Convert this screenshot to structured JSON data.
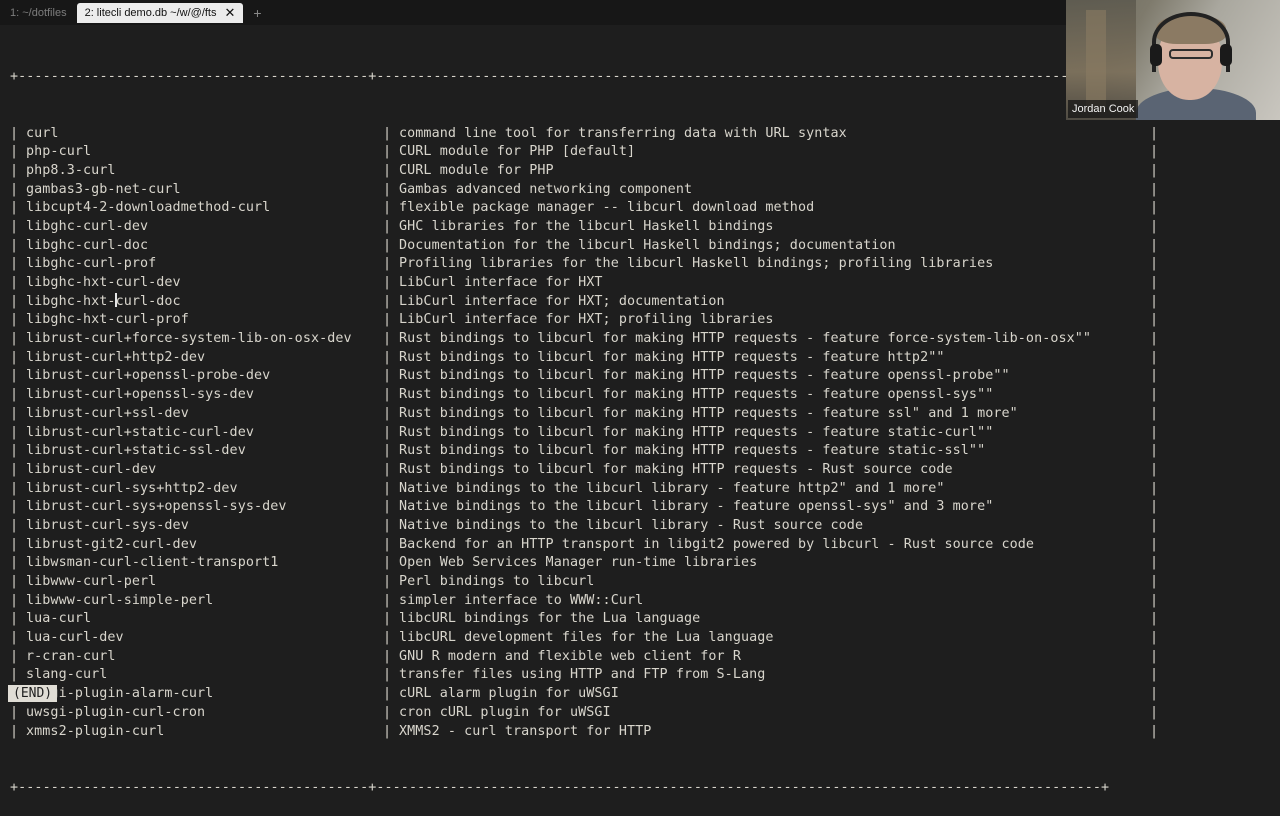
{
  "tabs": [
    {
      "label": "1: ~/dotfiles",
      "active": false
    },
    {
      "label": "2: litecli demo.db ~/w/@/fts",
      "active": true
    }
  ],
  "tab_close_glyph": "✕",
  "tab_add_glyph": "+",
  "table": {
    "border_top": "+-------------------------------------------+-----------------------------------------------------------------------------------------+",
    "border_bottom": "+-------------------------------------------+-----------------------------------------------------------------------------------------+",
    "rows": [
      {
        "name": "curl",
        "desc": "command line tool for transferring data with URL syntax"
      },
      {
        "name": "php-curl",
        "desc": "CURL module for PHP [default]"
      },
      {
        "name": "php8.3-curl",
        "desc": "CURL module for PHP"
      },
      {
        "name": "gambas3-gb-net-curl",
        "desc": "Gambas advanced networking component"
      },
      {
        "name": "libcupt4-2-downloadmethod-curl",
        "desc": "flexible package manager -- libcurl download method"
      },
      {
        "name": "libghc-curl-dev",
        "desc": "GHC libraries for the libcurl Haskell bindings"
      },
      {
        "name": "libghc-curl-doc",
        "desc": "Documentation for the libcurl Haskell bindings; documentation"
      },
      {
        "name": "libghc-curl-prof",
        "desc": "Profiling libraries for the libcurl Haskell bindings; profiling libraries"
      },
      {
        "name": "libghc-hxt-curl-dev",
        "desc": "LibCurl interface for HXT"
      },
      {
        "name": "libghc-hxt-curl-doc",
        "desc": "LibCurl interface for HXT; documentation"
      },
      {
        "name": "libghc-hxt-curl-prof",
        "desc": "LibCurl interface for HXT; profiling libraries"
      },
      {
        "name": "librust-curl+force-system-lib-on-osx-dev",
        "desc": "Rust bindings to libcurl for making HTTP requests - feature force-system-lib-on-osx\"\""
      },
      {
        "name": "librust-curl+http2-dev",
        "desc": "Rust bindings to libcurl for making HTTP requests - feature http2\"\""
      },
      {
        "name": "librust-curl+openssl-probe-dev",
        "desc": "Rust bindings to libcurl for making HTTP requests - feature openssl-probe\"\""
      },
      {
        "name": "librust-curl+openssl-sys-dev",
        "desc": "Rust bindings to libcurl for making HTTP requests - feature openssl-sys\"\""
      },
      {
        "name": "librust-curl+ssl-dev",
        "desc": "Rust bindings to libcurl for making HTTP requests - feature ssl\" and 1 more\""
      },
      {
        "name": "librust-curl+static-curl-dev",
        "desc": "Rust bindings to libcurl for making HTTP requests - feature static-curl\"\""
      },
      {
        "name": "librust-curl+static-ssl-dev",
        "desc": "Rust bindings to libcurl for making HTTP requests - feature static-ssl\"\""
      },
      {
        "name": "librust-curl-dev",
        "desc": "Rust bindings to libcurl for making HTTP requests - Rust source code"
      },
      {
        "name": "librust-curl-sys+http2-dev",
        "desc": "Native bindings to the libcurl library - feature http2\" and 1 more\""
      },
      {
        "name": "librust-curl-sys+openssl-sys-dev",
        "desc": "Native bindings to the libcurl library - feature openssl-sys\" and 3 more\""
      },
      {
        "name": "librust-curl-sys-dev",
        "desc": "Native bindings to the libcurl library - Rust source code"
      },
      {
        "name": "librust-git2-curl-dev",
        "desc": "Backend for an HTTP transport in libgit2 powered by libcurl - Rust source code"
      },
      {
        "name": "libwsman-curl-client-transport1",
        "desc": "Open Web Services Manager run-time libraries"
      },
      {
        "name": "libwww-curl-perl",
        "desc": "Perl bindings to libcurl"
      },
      {
        "name": "libwww-curl-simple-perl",
        "desc": "simpler interface to WWW::Curl"
      },
      {
        "name": "lua-curl",
        "desc": "libcURL bindings for the Lua language"
      },
      {
        "name": "lua-curl-dev",
        "desc": "libcURL development files for the Lua language"
      },
      {
        "name": "r-cran-curl",
        "desc": "GNU R modern and flexible web client for R"
      },
      {
        "name": "slang-curl",
        "desc": "transfer files using HTTP and FTP from S-Lang"
      },
      {
        "name": "uwsgi-plugin-alarm-curl",
        "desc": "cURL alarm plugin for uWSGI"
      },
      {
        "name": "uwsgi-plugin-curl-cron",
        "desc": "cron cURL plugin for uWSGI"
      },
      {
        "name": "xmms2-plugin-curl",
        "desc": "XMMS2 - curl transport for HTTP"
      }
    ]
  },
  "pager_status": "(END)",
  "webcam": {
    "name": "Jordan Cook"
  },
  "colors": {
    "background": "#1e1e1e",
    "text": "#d8d5cc",
    "active_tab": "#ececec",
    "status_bg": "#e0ddd5"
  }
}
